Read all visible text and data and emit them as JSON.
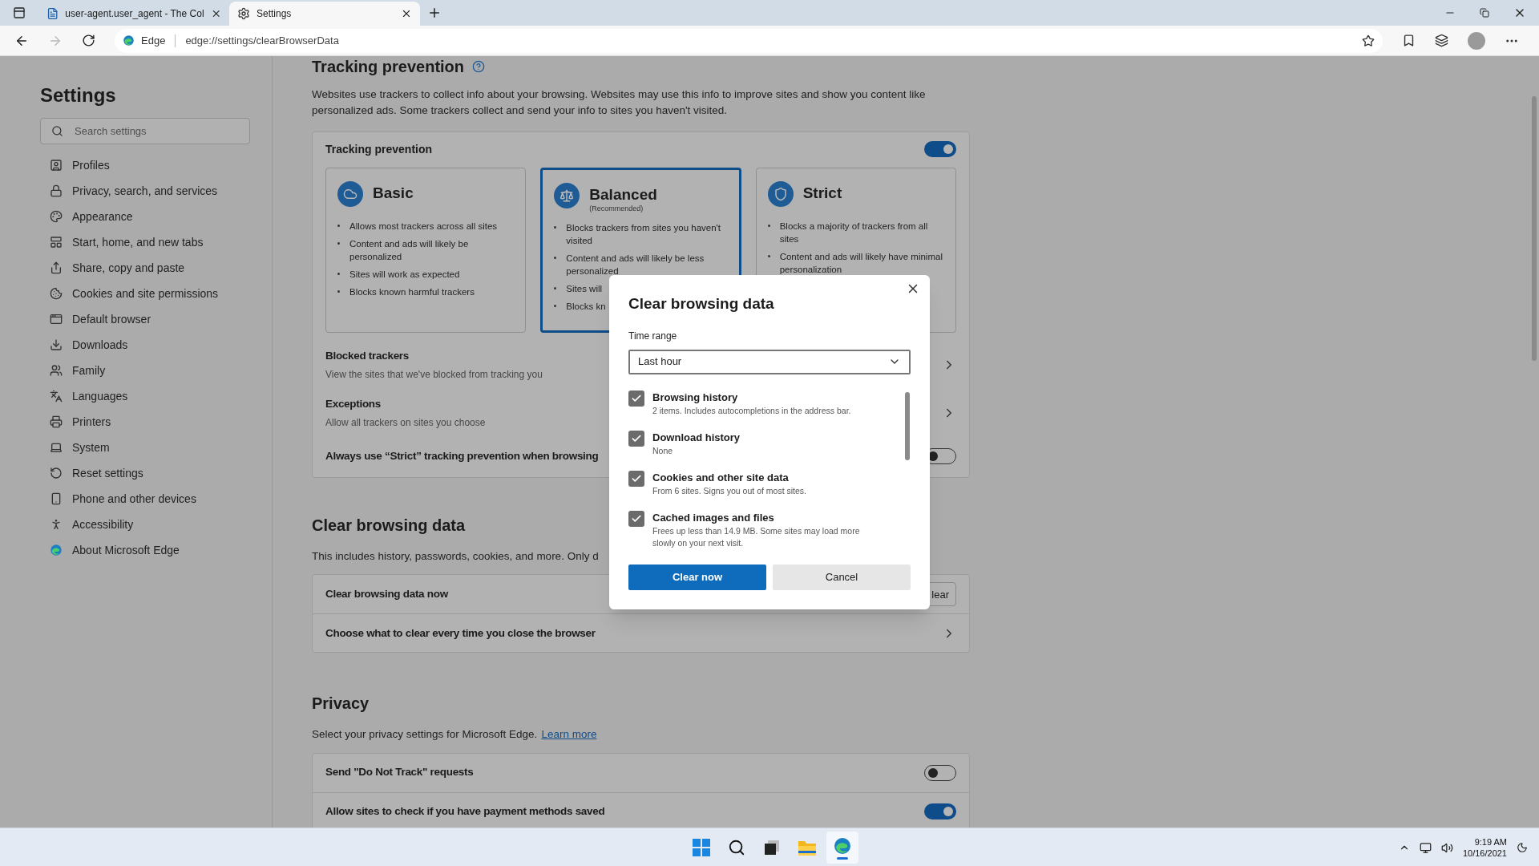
{
  "browser": {
    "tabs": [
      {
        "title": "user-agent.user_agent - The Col",
        "selected": false
      },
      {
        "title": "Settings",
        "selected": true
      }
    ],
    "address": {
      "site_label": "Edge",
      "url": "edge://settings/clearBrowserData"
    }
  },
  "sidebar": {
    "title": "Settings",
    "search": {
      "placeholder": "Search settings"
    },
    "items": [
      "Profiles",
      "Privacy, search, and services",
      "Appearance",
      "Start, home, and new tabs",
      "Share, copy and paste",
      "Cookies and site permissions",
      "Default browser",
      "Downloads",
      "Family",
      "Languages",
      "Printers",
      "System",
      "Reset settings",
      "Phone and other devices",
      "Accessibility",
      "About Microsoft Edge"
    ]
  },
  "tracking_prevention": {
    "heading": "Tracking prevention",
    "description": "Websites use trackers to collect info about your browsing. Websites may use this info to improve sites and show you content like personalized ads. Some trackers collect and send your info to sites you haven't visited.",
    "card": {
      "label": "Tracking prevention",
      "on": true,
      "options": [
        {
          "title": "Basic",
          "selected": false,
          "bullets": [
            "Allows most trackers across all sites",
            "Content and ads will likely be personalized",
            "Sites will work as expected",
            "Blocks known harmful trackers"
          ]
        },
        {
          "title": "Balanced",
          "subtitle": "(Recommended)",
          "selected": true,
          "bullets": [
            "Blocks trackers from sites you haven't visited",
            "Content and ads will likely be less personalized",
            "Sites will",
            "Blocks kn"
          ]
        },
        {
          "title": "Strict",
          "selected": false,
          "bullets": [
            "Blocks a majority of trackers from all sites",
            "Content and ads will likely have minimal personalization"
          ]
        }
      ],
      "rows": [
        {
          "kind": "link",
          "title": "Blocked trackers",
          "description": "View the sites that we've blocked from tracking you"
        },
        {
          "kind": "link",
          "title": "Exceptions",
          "description": "Allow all trackers on sites you choose"
        },
        {
          "kind": "toggle",
          "title": "Always use “Strict” tracking prevention when browsing",
          "on": false
        }
      ]
    }
  },
  "clear_browsing_data": {
    "heading": "Clear browsing data",
    "description": "This includes history, passwords, cookies, and more. Only d",
    "rows": [
      {
        "kind": "button",
        "title": "Clear browsing data now",
        "button": "lear"
      },
      {
        "kind": "link",
        "title": "Choose what to clear every time you close the browser"
      }
    ]
  },
  "privacy": {
    "heading": "Privacy",
    "description": "Select your privacy settings for Microsoft Edge.",
    "link": "Learn more",
    "rows": [
      {
        "kind": "toggle",
        "title": "Send \"Do Not Track\" requests",
        "on": false
      },
      {
        "kind": "toggle",
        "title": "Allow sites to check if you have payment methods saved",
        "on": true
      }
    ]
  },
  "dialog": {
    "title": "Clear browsing data",
    "time_range": {
      "label": "Time range",
      "value": "Last hour"
    },
    "items": [
      {
        "label": "Browsing history",
        "detail": "2 items. Includes autocompletions in the address bar.",
        "checked": true
      },
      {
        "label": "Download history",
        "detail": "None",
        "checked": true
      },
      {
        "label": "Cookies and other site data",
        "detail": "From 6 sites. Signs you out of most sites.",
        "checked": true
      },
      {
        "label": "Cached images and files",
        "detail": "Frees up less than 14.9 MB. Some sites may load more slowly on your next visit.",
        "checked": true
      }
    ],
    "primary_button": "Clear now",
    "secondary_button": "Cancel"
  },
  "taskbar": {
    "time": "9:19 AM",
    "date": "10/16/2021"
  }
}
